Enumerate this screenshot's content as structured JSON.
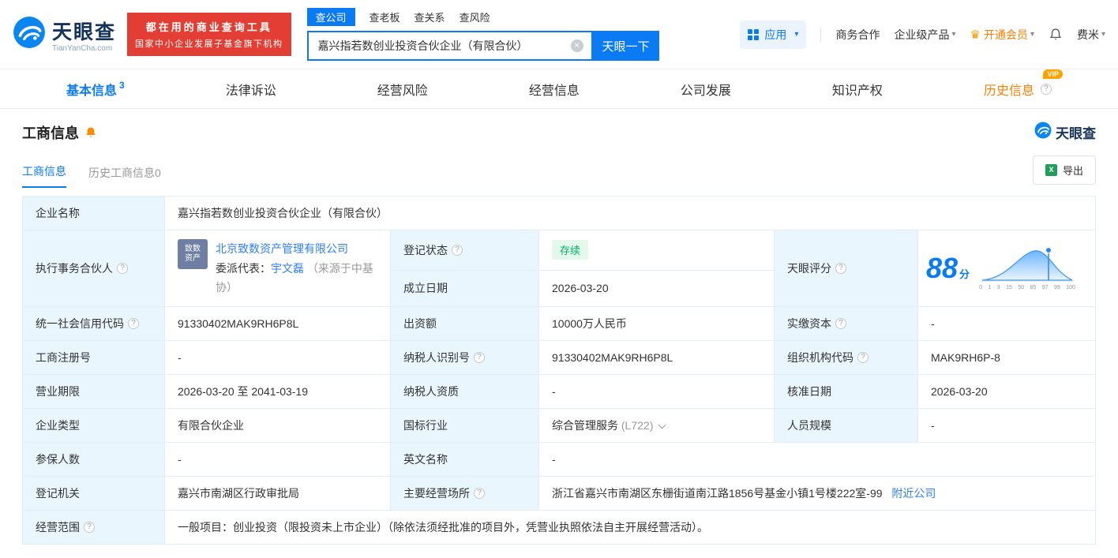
{
  "colors": {
    "accent": "#0b7bf3",
    "orange": "#ff7e00",
    "red": "#e23e33",
    "green": "#00b365",
    "label_bg": "#e9f6fd"
  },
  "icons": {
    "help": "?",
    "caret": "▾",
    "crown": "♛",
    "close": "×",
    "excel": "X"
  },
  "header": {
    "logo": {
      "brand": "天眼查",
      "domain": "TianYanCha.com"
    },
    "promo": {
      "line1": "都在用的商业查询工具",
      "line2": "国家中小企业发展子基金旗下机构"
    },
    "search": {
      "tabs": [
        "查公司",
        "查老板",
        "查关系",
        "查风险"
      ],
      "value": "嘉兴指若数创业投资合伙企业（有限合伙）",
      "button": "天眼一下"
    },
    "menu": {
      "apps": "应用",
      "cooperation": "商务合作",
      "enterprise": "企业级产品",
      "vip": "开通会员",
      "user": "费米"
    }
  },
  "nav": {
    "items": [
      {
        "label": "基本信息",
        "count": "3"
      },
      {
        "label": "法律诉讼"
      },
      {
        "label": "经营风险"
      },
      {
        "label": "经营信息"
      },
      {
        "label": "公司发展"
      },
      {
        "label": "知识产权"
      },
      {
        "label": "历史信息",
        "vip": "VIP"
      }
    ]
  },
  "section": {
    "title": "工商信息",
    "brand": "天眼查"
  },
  "subtabs": {
    "current": "工商信息",
    "history": "历史工商信息",
    "history_count": "0",
    "export": "导出"
  },
  "fields": {
    "company_name": {
      "label": "企业名称",
      "value": "嘉兴指若数创业投资合伙企业（有限合伙）"
    },
    "executive_partner": {
      "label": "执行事务合伙人",
      "company": "北京致数资产管理有限公司",
      "rep_prefix": "委派代表：",
      "rep_name": "宇文磊",
      "rep_source": "（来源于中基协）",
      "logo_line1": "致数",
      "logo_line2": "资产"
    },
    "reg_status": {
      "label": "登记状态",
      "value": "存续"
    },
    "establish_date": {
      "label": "成立日期",
      "value": "2026-03-20"
    },
    "score": {
      "label": "天眼评分",
      "value": "88",
      "unit": "分",
      "axis": [
        "0",
        "1",
        "3",
        "15",
        "50",
        "85",
        "97",
        "99",
        "100"
      ]
    },
    "credit_code": {
      "label": "统一社会信用代码",
      "value": "91330402MAK9RH6P8L"
    },
    "contribution": {
      "label": "出资额",
      "value": "10000万人民币"
    },
    "paid_capital": {
      "label": "实缴资本",
      "value": "-"
    },
    "reg_number": {
      "label": "工商注册号",
      "value": "-"
    },
    "taxpayer_id": {
      "label": "纳税人识别号",
      "value": "91330402MAK9RH6P8L"
    },
    "org_code": {
      "label": "组织机构代码",
      "value": "MAK9RH6P-8"
    },
    "business_term": {
      "label": "营业期限",
      "value": "2026-03-20 至 2041-03-19"
    },
    "taxpayer_quality": {
      "label": "纳税人资质",
      "value": "-"
    },
    "approval_date": {
      "label": "核准日期",
      "value": "2026-03-20"
    },
    "company_type": {
      "label": "企业类型",
      "value": "有限合伙企业"
    },
    "industry": {
      "label": "国标行业",
      "value": "综合管理服务",
      "code": "(L722)"
    },
    "staff_size": {
      "label": "人员规模",
      "value": "-"
    },
    "insured_count": {
      "label": "参保人数",
      "value": "-"
    },
    "english_name": {
      "label": "英文名称",
      "value": "-"
    },
    "reg_authority": {
      "label": "登记机关",
      "value": "嘉兴市南湖区行政审批局"
    },
    "main_premises": {
      "label": "主要经营场所",
      "value": "浙江省嘉兴市南湖区东栅街道南江路1856号基金小镇1号楼222室-99",
      "nearby": "附近公司"
    },
    "business_scope": {
      "label": "经营范围",
      "value": "一般项目：创业投资（限投资未上市企业）（除依法须经批准的项目外，凭营业执照依法自主开展经营活动）。"
    }
  }
}
